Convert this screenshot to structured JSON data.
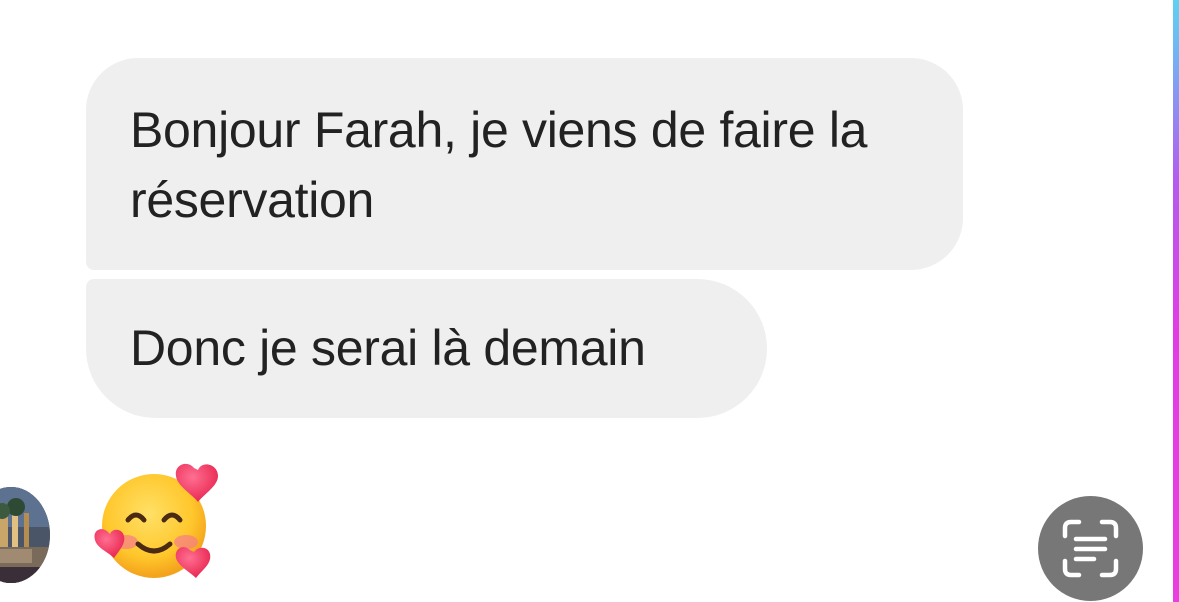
{
  "conversation": {
    "messages": [
      {
        "text": "Bonjour Farah, je viens de faire la réservation"
      },
      {
        "text": "Donc je serai là demain"
      }
    ],
    "reaction": {
      "emoji": "🥰",
      "icon": "smiling-face-with-hearts-icon"
    }
  },
  "contact": {
    "avatar_icon": "contact-avatar"
  },
  "controls": {
    "text_scan_icon": "scan-text-icon"
  },
  "colors": {
    "bubble_background": "#efeff0",
    "text": "#222222",
    "scan_button": "#777777",
    "edge_gradient_top": "#5ed1f2",
    "edge_gradient_bottom": "#e93ee0"
  }
}
